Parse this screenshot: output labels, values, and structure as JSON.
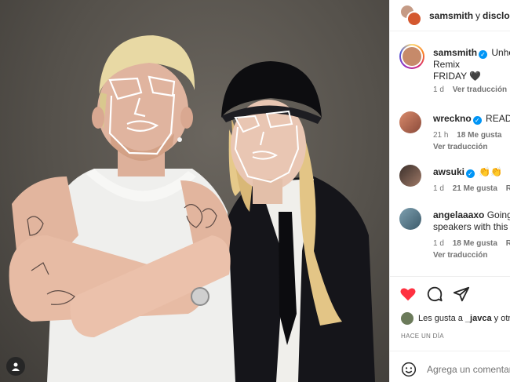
{
  "post": {
    "header": {
      "username": "samsmith",
      "conjunction": "y",
      "coauthor": "disclosu"
    },
    "caption": {
      "username": "samsmith",
      "text_line1": "Unhol",
      "text_line2": "Remix",
      "text_line3": "FRIDAY 🖤",
      "time": "1 d",
      "translate": "Ver traducción"
    },
    "comments": [
      {
        "username": "wreckno",
        "text": "READY",
        "time": "21 h",
        "likes": "18 Me gusta",
        "reply": "",
        "translate": "Ver traducción",
        "verified": true
      },
      {
        "username": "awsuki",
        "text": "👏👏",
        "time": "1 d",
        "likes": "21 Me gusta",
        "reply": "Re",
        "translate": "",
        "verified": true
      },
      {
        "username": "angelaaaxo",
        "text": "Going",
        "text_line2": "speakers with this c",
        "time": "1 d",
        "likes": "18 Me gusta",
        "reply": "Re",
        "translate": "Ver traducción",
        "verified": false
      }
    ],
    "liked_by": {
      "prefix": "Les gusta a",
      "user": "_javca",
      "suffix": "y otr"
    },
    "posted_ago": "HACE UN DÍA",
    "comment_placeholder": "Agrega un comentari"
  },
  "icons": {
    "heart": "heart-icon",
    "comment": "comment-icon",
    "share": "share-icon",
    "emoji": "emoji-icon",
    "tag": "user-tag-icon"
  },
  "colors": {
    "like_red": "#ff3040",
    "verified_blue": "#0095f6",
    "muted": "#737373"
  }
}
